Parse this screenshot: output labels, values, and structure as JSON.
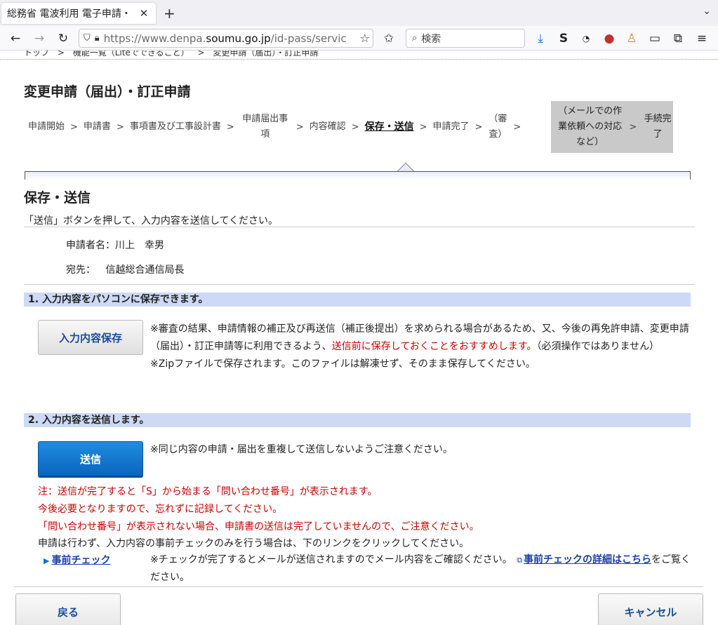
{
  "browser": {
    "tab_title": "総務省 電波利用 電子申請・",
    "tab_close": "✕",
    "new_tab": "+",
    "url_prefix": "https://www.denpa.",
    "url_host": "soumu.go.jp",
    "url_path": "/id-pass/servic",
    "search_placeholder": "検索"
  },
  "breadcrumb": {
    "items": [
      "トップ",
      "機能一覧（Liteでできること）",
      "変更申請（届出）・訂正申請"
    ],
    "separator": ">"
  },
  "page_title": "変更申請（届出）・訂正申請",
  "steps": {
    "items": [
      "申請開始",
      "申請書",
      "事項書及び工事設計書",
      "申請届出事項",
      "内容確認",
      "保存・送信",
      "申請完了",
      "（審査）",
      "（メールでの作業依頼への対応など）",
      "手続完了"
    ],
    "separator": ">",
    "active_index": 5
  },
  "section_title": "保存・送信",
  "instruction": "「送信」ボタンを押して、入力内容を送信してください。",
  "applicant": {
    "name_label": "申請者名：",
    "name_value": "川上　幸男",
    "dest_label": "宛先：",
    "dest_value": "信越総合通信局長"
  },
  "save_section": {
    "heading": "1. 入力内容をパソコンに保存できます。",
    "button_label": "入力内容保存",
    "note1_a": "※審査の結果、申請情報の補正及び再送信（補正後提出）を求められる場合があるため、又、今後の再免許申請、変更申請（届出）・訂正申請等に利用できるよう、",
    "note1_red": "送信前に保存しておくことをおすすめします。",
    "note1_b": "（必須操作ではありません）",
    "note2": "※Zipファイルで保存されます。このファイルは解凍せず、そのまま保存してください。"
  },
  "send_section": {
    "heading": "2. 入力内容を送信します。",
    "button_label": "送信",
    "note": "※同じ内容の申請・届出を重複して送信しないようご注意ください。",
    "warning1": "注：送信が完了すると「S」から始まる「問い合わせ番号」が表示されます。",
    "warning2": "今後必要となりますので、忘れずに記録してください。",
    "warning3": "「問い合わせ番号」が表示されない場合、申請書の送信は完了していませんので、ご注意ください。",
    "precheck_intro": "申請は行わず、入力内容の事前チェックのみを行う場合は、下のリンクをクリックしてください。",
    "precheck_link": "事前チェック",
    "precheck_note": "※チェックが完了するとメールが送信されますのでメール内容をご確認ください。",
    "detail_link": "事前チェックの詳細はこちら",
    "detail_suffix": "をご覧ください。"
  },
  "footer": {
    "back_label": "戻る",
    "cancel_label": "キャンセル"
  }
}
